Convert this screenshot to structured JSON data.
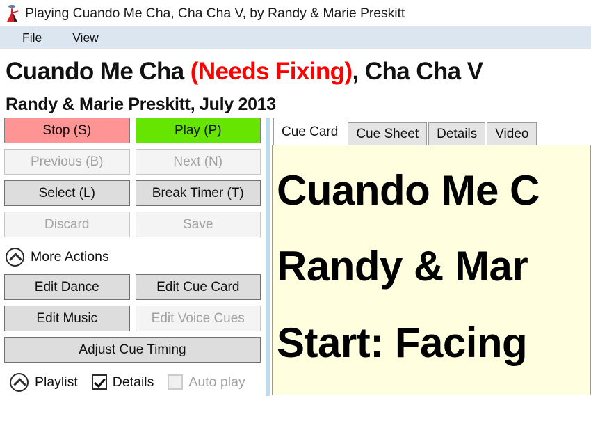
{
  "window": {
    "title": "Playing Cuando Me Cha, Cha Cha V, by Randy & Marie Preskitt",
    "icon": "dancer-icon"
  },
  "menubar": {
    "items": [
      {
        "label": "File"
      },
      {
        "label": "View"
      }
    ]
  },
  "heading": {
    "title_before": "Cuando Me Cha ",
    "title_status": "(Needs Fixing)",
    "title_after": ", Cha Cha V",
    "subtitle": "Randy & Marie Preskitt, July 2013",
    "status_color": "#ff0000"
  },
  "transport": {
    "stop_label": "Stop (S)",
    "play_label": "Play (P)",
    "previous_label": "Previous (B)",
    "next_label": "Next (N)",
    "select_label": "Select (L)",
    "break_timer_label": "Break Timer (T)",
    "discard_label": "Discard",
    "save_label": "Save",
    "stop_color": "#ff9494",
    "play_color": "#66e500"
  },
  "more_actions": {
    "label": "More Actions",
    "edit_dance_label": "Edit Dance",
    "edit_cue_card_label": "Edit Cue Card",
    "edit_music_label": "Edit Music",
    "edit_voice_cues_label": "Edit Voice Cues",
    "adjust_cue_timing_label": "Adjust Cue Timing"
  },
  "bottombar": {
    "playlist_label": "Playlist",
    "details_label": "Details",
    "auto_play_label": "Auto play"
  },
  "tabs": [
    {
      "label": "Cue Card"
    },
    {
      "label": "Cue Sheet"
    },
    {
      "label": "Details"
    },
    {
      "label": "Video"
    }
  ],
  "cue_card": {
    "lines": [
      "Cuando Me C",
      "Randy & Mar",
      "Start: Facing"
    ],
    "background": "#ffffe0"
  }
}
